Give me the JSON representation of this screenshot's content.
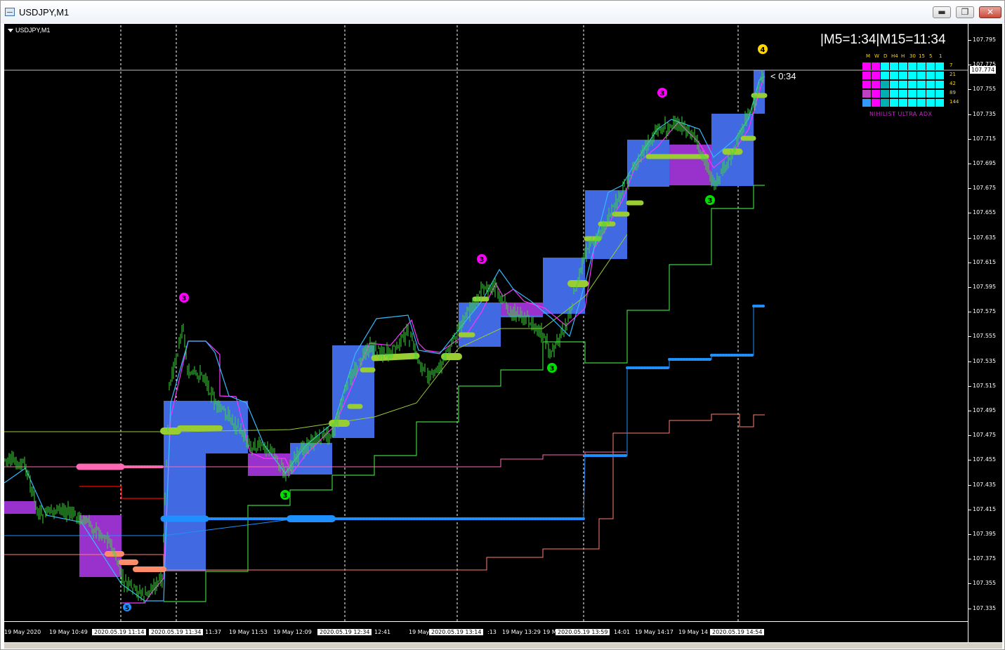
{
  "window": {
    "title": "USDJPY,M1"
  },
  "buttons": {
    "minimize": "▬",
    "maximize": "❐",
    "close": "✕"
  },
  "chart": {
    "symbol_label": "USDJPY,M1",
    "timer": "|M5=1:34|M15=11:34",
    "bar_countdown": "< 0:34",
    "current_price": "107.774",
    "price_ticks": [
      "107.795",
      "107.775",
      "107.755",
      "107.735",
      "107.715",
      "107.695",
      "107.675",
      "107.655",
      "107.635",
      "107.615",
      "107.595",
      "107.575",
      "107.555",
      "107.535",
      "107.515",
      "107.495",
      "107.475",
      "107.455",
      "107.435",
      "107.415",
      "107.395",
      "107.375",
      "107.355",
      "107.335"
    ],
    "time_ticks": [
      {
        "label": "19 May 2020",
        "hl": false
      },
      {
        "label": "19 May 10:49",
        "hl": false
      },
      {
        "label": "2020.05.19 11:14",
        "hl": true
      },
      {
        "label": "2020.05.19 11:34",
        "hl": true
      },
      {
        "label": "11:37",
        "hl": false
      },
      {
        "label": "19 May 11:53",
        "hl": false
      },
      {
        "label": "19 May 12:09",
        "hl": false
      },
      {
        "label": "2020.05.19 12:34",
        "hl": true
      },
      {
        "label": "12:41",
        "hl": false
      },
      {
        "label": "19 May",
        "hl": false
      },
      {
        "label": "2020.05.19 13:14",
        "hl": true
      },
      {
        "label": ":13",
        "hl": false
      },
      {
        "label": "19 May 13:29",
        "hl": false
      },
      {
        "label": "19 M",
        "hl": false
      },
      {
        "label": "2020.05.19 13:59",
        "hl": true
      },
      {
        "label": "14:01",
        "hl": false
      },
      {
        "label": "19 May 14:17",
        "hl": false
      },
      {
        "label": "19 May 14",
        "hl": false
      },
      {
        "label": "2020.05.19 14:54",
        "hl": true
      }
    ],
    "markers": [
      "5",
      "3",
      "3",
      "3",
      "3",
      "3",
      "3",
      "4"
    ],
    "adx_panel": {
      "title": "NIHILIST ULTRA ADX",
      "columns": [
        "M",
        "W",
        "D",
        "H4",
        "H",
        "30",
        "15",
        "5",
        "1"
      ],
      "rows": [
        "7",
        "21",
        "42",
        "89",
        "144"
      ],
      "cells": [
        [
          "#ff00ff",
          "#ff00ff",
          "#00ffff",
          "#00ffff",
          "#00ffff",
          "#00ffff",
          "#00ffff",
          "#00ffff",
          "#00ffff"
        ],
        [
          "#ff00ff",
          "#ff00ff",
          "#00ffff",
          "#00ffff",
          "#00ffff",
          "#00ffff",
          "#00ffff",
          "#00ffff",
          "#00ffff"
        ],
        [
          "#ff00ff",
          "#ff00ff",
          "#00b0b0",
          "#00ffff",
          "#00ffff",
          "#00ffff",
          "#00ffff",
          "#00ffff",
          "#00ffff"
        ],
        [
          "#c040c0",
          "#ff00ff",
          "#00b0b0",
          "#00ffff",
          "#00ffff",
          "#00ffff",
          "#00ffff",
          "#00ffff",
          "#00ffff"
        ],
        [
          "#3399ff",
          "#ff00ff",
          "#00b0b0",
          "#00ffff",
          "#00ffff",
          "#00ffff",
          "#00ffff",
          "#00ffff",
          "#00ffff"
        ]
      ]
    },
    "colors": {
      "background": "#000000",
      "candles": "#3dd63d",
      "bull_box": "#4169e1",
      "bear_box": "#9932cc",
      "green_line": "#3ad13a",
      "blue_line": "#1e90ff",
      "salmon_line": "#ff7f6f",
      "pink_line": "#ff69b4",
      "magenta_line": "#ff33ff",
      "cyan_line": "#33bbff",
      "olive_dots": "#9acd32"
    }
  }
}
